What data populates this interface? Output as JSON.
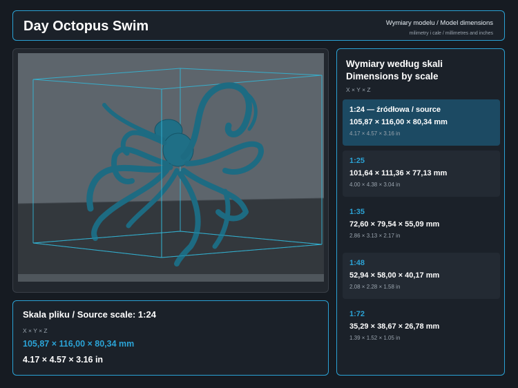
{
  "header": {
    "title": "Day Octopus Swim",
    "dimensions_label": "Wymiary modelu / Model dimensions",
    "units_label": "milimetry i cale / millimetres and inches"
  },
  "source_panel": {
    "title": "Skala pliku / Source scale: 1:24",
    "axes": "X × Y × Z",
    "mm": "105,87 × 116,00 × 80,34 mm",
    "in": "4.17 × 4.57 × 3.16 in"
  },
  "scales_panel": {
    "title_pl": "Wymiary według skali",
    "title_en": "Dimensions by scale",
    "axes": "X × Y × Z",
    "items": [
      {
        "label": "1:24  —  źródłowa / source",
        "mm": "105,87 × 116,00 × 80,34 mm",
        "in": "4.17 × 4.57 × 3.16 in"
      },
      {
        "label": "1:25",
        "mm": "101,64 × 111,36 × 77,13 mm",
        "in": "4.00 × 4.38 × 3.04 in"
      },
      {
        "label": "1:35",
        "mm": "72,60 × 79,54 × 55,09 mm",
        "in": "2.86 × 3.13 × 2.17 in"
      },
      {
        "label": "1:48",
        "mm": "52,94 × 58,00 × 40,17 mm",
        "in": "2.08 × 2.28 × 1.58 in"
      },
      {
        "label": "1:72",
        "mm": "35,29 × 38,67 × 26,78 mm",
        "in": "1.39 × 1.52 × 1.05 in"
      }
    ]
  },
  "colors": {
    "accent": "#2ba3d6",
    "model": "#1f6f86",
    "active_bg": "#1c4a63",
    "background": "#161b22"
  }
}
